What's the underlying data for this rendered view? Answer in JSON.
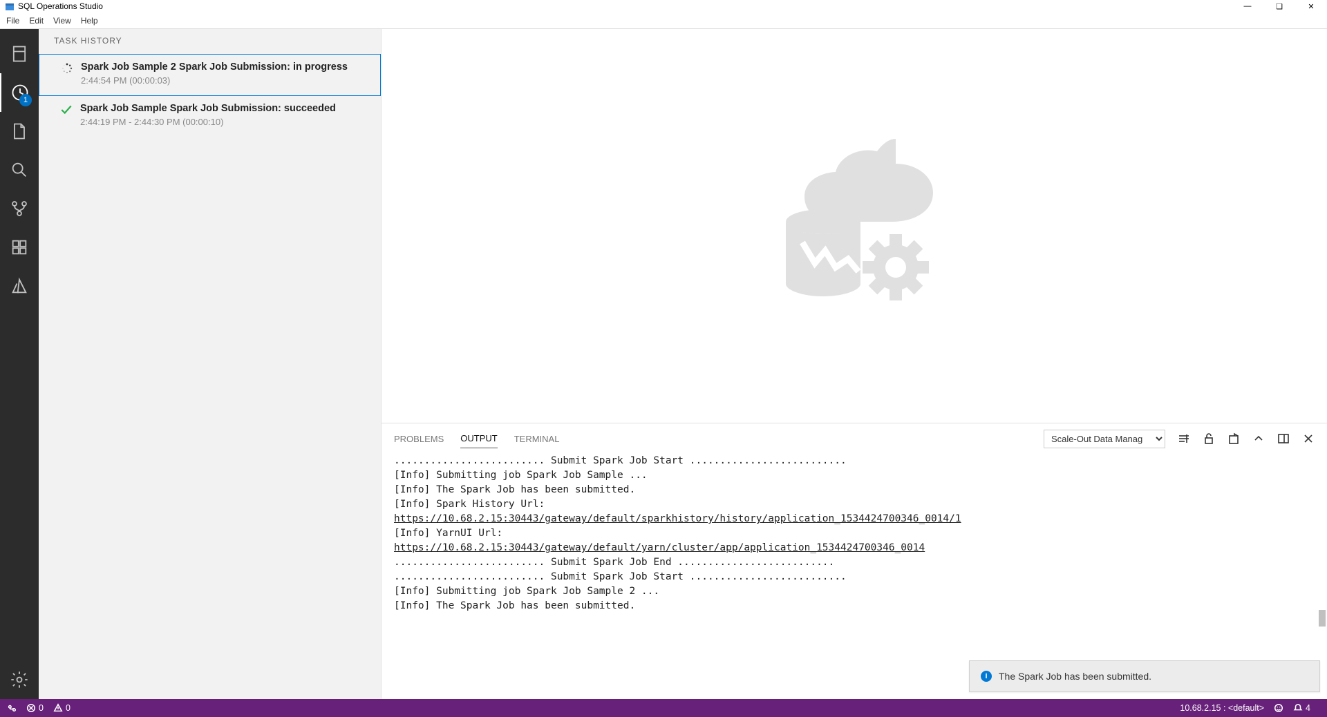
{
  "app": {
    "title": "SQL Operations Studio"
  },
  "menu": {
    "file": "File",
    "edit": "Edit",
    "view": "View",
    "help": "Help"
  },
  "activity": {
    "badge": "1"
  },
  "sidebar": {
    "header": "TASK HISTORY",
    "tasks": [
      {
        "title": "Spark Job Sample 2 Spark Job Submission: in progress",
        "time": "2:44:54 PM (00:00:03)",
        "status": "progress"
      },
      {
        "title": "Spark Job Sample Spark Job Submission: succeeded",
        "time": "2:44:19 PM - 2:44:30 PM (00:00:10)",
        "status": "success"
      }
    ]
  },
  "panel": {
    "tabs": {
      "problems": "PROBLEMS",
      "output": "OUTPUT",
      "terminal": "TERMINAL"
    },
    "select": "Scale-Out Data Manag",
    "output_lines": [
      "......................... Submit Spark Job Start ..........................",
      "[Info]  Submitting job Spark Job Sample ...",
      "[Info]  The Spark Job has been submitted.",
      "[Info]  Spark History Url:",
      "https://10.68.2.15:30443/gateway/default/sparkhistory/history/application_1534424700346_0014/1",
      "[Info]  YarnUI Url:",
      "https://10.68.2.15:30443/gateway/default/yarn/cluster/app/application_1534424700346_0014",
      "......................... Submit Spark Job End ..........................",
      "......................... Submit Spark Job Start ..........................",
      "[Info]  Submitting job Spark Job Sample 2 ...",
      "[Info]  The Spark Job has been submitted."
    ],
    "url_line_indices": [
      4,
      6
    ]
  },
  "toast": {
    "text": "The Spark Job has been submitted."
  },
  "status": {
    "errors": "0",
    "warnings": "0",
    "connection": "10.68.2.15 : <default>",
    "bell": "4"
  }
}
